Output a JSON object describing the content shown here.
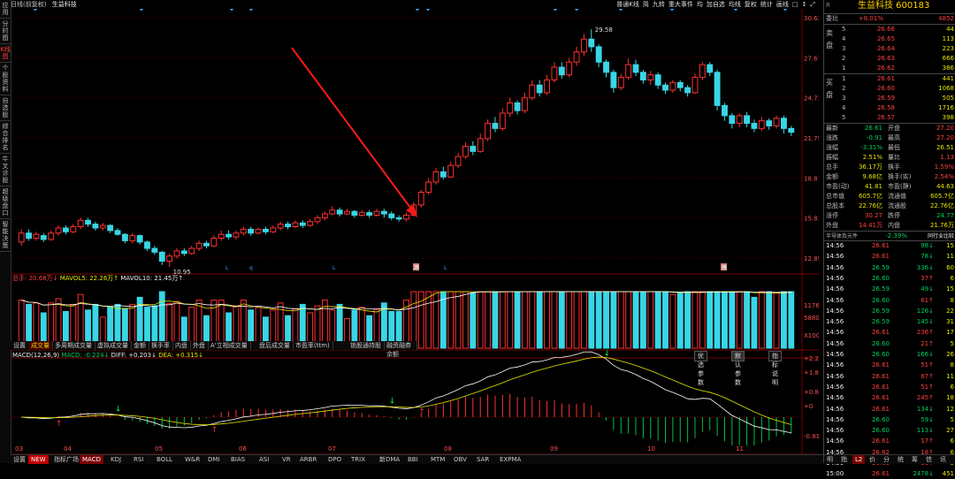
{
  "left_tabs": [
    "应用",
    "分时图",
    "K线图",
    "个股资料",
    "自选股",
    "综合排名",
    "牛叉诊股",
    "超级盘口",
    "智能决策"
  ],
  "left_tab_active": 2,
  "header": {
    "period": "日线(前复权)",
    "stock_name": "生益科技",
    "tools": [
      "普通K线",
      "简",
      "九转",
      "重大事件",
      "均",
      "加自选",
      "均线",
      "复权",
      "统计",
      "画线",
      "□",
      "↕",
      "⤢"
    ]
  },
  "price_axis": [
    "30.62",
    "27.67",
    "24.73",
    "21.75",
    "18.81",
    "15.83",
    "12.89"
  ],
  "price_annotations": {
    "high": "29.58",
    "low": "10.95"
  },
  "event_markers": [
    "L",
    "q",
    "L",
    "港",
    "L",
    "榜"
  ],
  "volume_legend": {
    "total": "总手: 20.68万↓",
    "ma5": "MAVOL5: 22.26万↑",
    "ma10": "MAVOL10: 21.45万↑"
  },
  "volume_axis": [
    "11760",
    "5880",
    "X100"
  ],
  "volume_tabs": [
    "设置",
    "成交量",
    "多周期成交量",
    "虚拟成交量",
    "金额",
    "换手率",
    "内盘",
    "外盘",
    "A'立相成交量",
    "盘后成交量",
    "市盈率(ttm)",
    "锁股通持股",
    "融资融券余额"
  ],
  "volume_tab_active": 1,
  "macd_legend": {
    "name": "MACD(12,26,9)",
    "macd": "MACD: -0.224↓",
    "diff": "DIFF: +0.203↓",
    "dea": "DEA: +0.315↓"
  },
  "macd_buttons": [
    "优选参数",
    "默认参数",
    "指标说明"
  ],
  "macd_axis": [
    "+2.20",
    "+1.86",
    "+0.835",
    "+0",
    "-0.819"
  ],
  "months": [
    "03",
    "04",
    "05",
    "06",
    "07",
    "08",
    "09",
    "10",
    "11"
  ],
  "bottom_tabs": [
    "设置",
    "NEW",
    "指标广场",
    "MACD",
    "KDJ",
    "RSI",
    "BOLL",
    "W&R",
    "DMI",
    "BIAS",
    "ASI",
    "VR",
    "ARBR",
    "DPO",
    "TRIX",
    "新DMA",
    "BBI",
    "MTM",
    "OBV",
    "SAR",
    "EXPMA"
  ],
  "bottom_tab_active": 3,
  "panel": {
    "symbol_r": "R",
    "title": "生益科技 600183",
    "weibi_label": "委比",
    "weibi_value": "+8.01%",
    "weibi_right": "4852",
    "sell_label": "卖盘",
    "buy_label": "买盘",
    "sell": [
      {
        "lvl": "5",
        "price": "26.66",
        "vol": "44"
      },
      {
        "lvl": "4",
        "price": "26.65",
        "vol": "113"
      },
      {
        "lvl": "3",
        "price": "26.64",
        "vol": "223"
      },
      {
        "lvl": "2",
        "price": "26.63",
        "vol": "666"
      },
      {
        "lvl": "1",
        "price": "26.62",
        "vol": "386"
      }
    ],
    "buy": [
      {
        "lvl": "1",
        "price": "26.61",
        "vol": "441"
      },
      {
        "lvl": "2",
        "price": "26.60",
        "vol": "1068"
      },
      {
        "lvl": "3",
        "price": "26.59",
        "vol": "505"
      },
      {
        "lvl": "4",
        "price": "26.58",
        "vol": "1716"
      },
      {
        "lvl": "5",
        "price": "26.57",
        "vol": "398"
      }
    ],
    "stats": [
      [
        "最新",
        "26.61",
        "开盘",
        "27.20"
      ],
      [
        "涨跌",
        "-0.91",
        "最高",
        "27.20"
      ],
      [
        "涨幅",
        "-3.31%",
        "最低",
        "26.51"
      ],
      [
        "振幅",
        "2.51%",
        "量比",
        "1.13"
      ],
      [
        "总手",
        "36.17万",
        "换手",
        "1.59%"
      ],
      [
        "金额",
        "9.68亿",
        "换手(实)",
        "2.54%"
      ],
      [
        "市盈(动)",
        "41.81",
        "市盈(静)",
        "44.63"
      ],
      [
        "总市值",
        "605.7亿",
        "流通值",
        "605.7亿"
      ],
      [
        "总股本",
        "22.76亿",
        "流通股",
        "22.76亿"
      ],
      [
        "涨停",
        "30.27",
        "跌停",
        "24.77"
      ],
      [
        "外盘",
        "14.41万",
        "内盘",
        "21.76万"
      ]
    ],
    "sector": "半导体及元件",
    "sector_change": "-2.39%",
    "sector_compare": "同行业比较",
    "ticks": [
      [
        "14:56",
        "26.61",
        "98",
        "↓",
        "15"
      ],
      [
        "14:56",
        "26.61",
        "78",
        "↓",
        "11"
      ],
      [
        "14:56",
        "26.59",
        "336",
        "↓",
        "60"
      ],
      [
        "14:56",
        "26.60",
        "37",
        "↑",
        "6"
      ],
      [
        "14:56",
        "26.59",
        "49",
        "↓",
        "15"
      ],
      [
        "14:56",
        "26.60",
        "61",
        "↑",
        "8"
      ],
      [
        "14:56",
        "26.59",
        "126",
        "↓",
        "22"
      ],
      [
        "14:56",
        "26.59",
        "145",
        "↓",
        "31"
      ],
      [
        "14:56",
        "26.61",
        "236",
        "↑",
        "17"
      ],
      [
        "14:56",
        "26.60",
        "21",
        "↑",
        "5"
      ],
      [
        "14:56",
        "26.60",
        "166",
        "↓",
        "26"
      ],
      [
        "14:56",
        "26.61",
        "51",
        "↑",
        "8"
      ],
      [
        "14:56",
        "26.61",
        "87",
        "↑",
        "11"
      ],
      [
        "14:56",
        "26.61",
        "51",
        "↑",
        "6"
      ],
      [
        "14:56",
        "26.61",
        "245",
        "↑",
        "18"
      ],
      [
        "14:56",
        "26.61",
        "134",
        "↓",
        "12"
      ],
      [
        "14:56",
        "26.60",
        "59",
        "↓",
        "5"
      ],
      [
        "14:56",
        "26.60",
        "113",
        "↓",
        "27"
      ],
      [
        "14:56",
        "26.61",
        "17",
        "↑",
        "6"
      ],
      [
        "14:56",
        "26.62",
        "18",
        "↑",
        "6"
      ],
      [
        "14:56",
        "26.63",
        "56",
        "↑",
        "8"
      ],
      [
        "15:00",
        "26.61",
        "2478",
        "↓",
        "451"
      ]
    ],
    "bottom_tabs": [
      "明",
      "指",
      "L2",
      "价",
      "分",
      "统",
      "筹",
      "信",
      "讯"
    ],
    "bottom_tab_active": 2
  },
  "chart_data": {
    "type": "candlestick",
    "x_axis_months": [
      "03",
      "04",
      "05",
      "06",
      "07",
      "08",
      "09",
      "10",
      "11"
    ],
    "price_ylim": [
      10.95,
      30.62
    ],
    "annotations": [
      {
        "label": "29.58",
        "type": "high"
      },
      {
        "label": "10.95",
        "type": "low"
      }
    ],
    "candles": [
      [
        12.9,
        13.6,
        12.6,
        13.9
      ],
      [
        13.6,
        13.2,
        13.0,
        13.9
      ],
      [
        13.2,
        13.5,
        13.0,
        13.7
      ],
      [
        13.4,
        13.1,
        12.9,
        13.6
      ],
      [
        13.1,
        13.6,
        13.0,
        13.8
      ],
      [
        13.6,
        14.0,
        13.4,
        14.2
      ],
      [
        14.0,
        13.7,
        13.5,
        14.2
      ],
      [
        13.7,
        14.1,
        13.6,
        14.3
      ],
      [
        14.1,
        14.6,
        13.9,
        14.8
      ],
      [
        14.6,
        14.3,
        14.1,
        14.8
      ],
      [
        14.3,
        14.0,
        13.8,
        14.5
      ],
      [
        14.0,
        14.2,
        13.8,
        14.4
      ],
      [
        14.2,
        13.8,
        13.6,
        14.3
      ],
      [
        13.8,
        13.5,
        13.4,
        14.0
      ],
      [
        13.5,
        13.0,
        12.8,
        13.6
      ],
      [
        13.0,
        13.4,
        12.8,
        13.6
      ],
      [
        13.4,
        12.9,
        12.7,
        13.5
      ],
      [
        12.9,
        12.4,
        12.2,
        13.0
      ],
      [
        12.4,
        12.1,
        11.9,
        12.6
      ],
      [
        12.1,
        11.4,
        11.1,
        12.2
      ],
      [
        11.4,
        11.8,
        10.95,
        12.0
      ],
      [
        11.8,
        12.2,
        11.6,
        12.4
      ],
      [
        12.2,
        12.0,
        11.8,
        12.4
      ],
      [
        12.0,
        12.4,
        11.9,
        12.6
      ],
      [
        12.4,
        12.8,
        12.2,
        13.0
      ],
      [
        12.8,
        12.6,
        12.4,
        13.0
      ],
      [
        12.6,
        13.2,
        12.5,
        13.4
      ],
      [
        13.2,
        13.5,
        13.0,
        13.8
      ],
      [
        13.5,
        13.3,
        13.1,
        13.8
      ],
      [
        13.3,
        13.6,
        13.1,
        13.8
      ],
      [
        13.6,
        13.9,
        13.4,
        14.1
      ],
      [
        13.9,
        13.6,
        13.4,
        14.1
      ],
      [
        13.6,
        13.9,
        13.5,
        14.0
      ],
      [
        13.9,
        13.7,
        13.5,
        14.1
      ],
      [
        13.7,
        14.0,
        13.6,
        14.2
      ],
      [
        14.0,
        14.3,
        13.8,
        14.5
      ],
      [
        14.3,
        14.1,
        13.9,
        14.5
      ],
      [
        14.1,
        14.4,
        14.0,
        14.6
      ],
      [
        14.4,
        14.2,
        14.0,
        14.6
      ],
      [
        14.2,
        14.5,
        14.1,
        14.7
      ],
      [
        14.5,
        14.8,
        14.3,
        15.0
      ],
      [
        14.8,
        15.1,
        14.6,
        15.3
      ],
      [
        15.1,
        15.4,
        15.0,
        15.7
      ],
      [
        15.4,
        15.1,
        14.9,
        15.6
      ],
      [
        15.1,
        15.3,
        15.0,
        15.5
      ],
      [
        15.3,
        15.0,
        14.8,
        15.4
      ],
      [
        15.0,
        15.2,
        14.9,
        15.4
      ],
      [
        15.2,
        15.0,
        14.8,
        15.4
      ],
      [
        15.0,
        15.3,
        14.9,
        15.5
      ],
      [
        15.3,
        15.1,
        14.8,
        15.5
      ],
      [
        15.1,
        14.8,
        14.6,
        15.3
      ],
      [
        14.8,
        14.7,
        14.5,
        15.0
      ],
      [
        14.7,
        15.0,
        14.5,
        15.2
      ],
      [
        15.0,
        15.8,
        14.9,
        16.0
      ],
      [
        15.8,
        16.8,
        15.6,
        17.0
      ],
      [
        16.8,
        17.6,
        16.6,
        17.9
      ],
      [
        17.6,
        18.4,
        17.4,
        18.7
      ],
      [
        18.4,
        18.0,
        17.8,
        18.8
      ],
      [
        18.0,
        18.9,
        17.9,
        19.2
      ],
      [
        18.9,
        19.6,
        18.7,
        19.9
      ],
      [
        19.6,
        20.4,
        19.4,
        20.7
      ],
      [
        20.4,
        20.0,
        19.7,
        20.8
      ],
      [
        20.0,
        21.0,
        19.9,
        21.4
      ],
      [
        21.0,
        22.2,
        20.8,
        22.5
      ],
      [
        22.2,
        21.8,
        21.5,
        22.7
      ],
      [
        21.8,
        23.0,
        21.6,
        23.4
      ],
      [
        23.0,
        23.8,
        22.7,
        24.2
      ],
      [
        23.8,
        23.2,
        22.9,
        24.0
      ],
      [
        23.2,
        24.2,
        23.0,
        24.6
      ],
      [
        24.2,
        25.2,
        24.0,
        25.6
      ],
      [
        25.2,
        24.6,
        24.3,
        25.6
      ],
      [
        24.6,
        25.6,
        24.4,
        26.0
      ],
      [
        25.6,
        26.6,
        25.4,
        27.0
      ],
      [
        26.6,
        26.0,
        25.7,
        27.0
      ],
      [
        26.0,
        27.0,
        25.8,
        27.3
      ],
      [
        27.0,
        27.8,
        26.7,
        28.2
      ],
      [
        27.8,
        28.8,
        27.5,
        29.2
      ],
      [
        28.8,
        28.2,
        27.8,
        29.58
      ],
      [
        28.2,
        27.0,
        26.6,
        28.4
      ],
      [
        27.0,
        26.2,
        25.8,
        27.2
      ],
      [
        26.2,
        25.0,
        24.6,
        26.4
      ],
      [
        25.0,
        25.8,
        24.8,
        26.1
      ],
      [
        25.8,
        26.8,
        25.6,
        27.3
      ],
      [
        26.8,
        26.2,
        25.9,
        27.2
      ],
      [
        26.2,
        25.6,
        25.3,
        26.4
      ],
      [
        25.6,
        26.0,
        25.2,
        26.3
      ],
      [
        26.0,
        25.2,
        24.9,
        26.2
      ],
      [
        25.2,
        24.8,
        24.5,
        25.4
      ],
      [
        24.8,
        25.4,
        24.6,
        25.6
      ],
      [
        25.4,
        25.0,
        24.7,
        25.6
      ],
      [
        25.0,
        24.6,
        24.3,
        25.2
      ],
      [
        24.6,
        25.8,
        24.5,
        26.1
      ],
      [
        25.8,
        26.8,
        25.6,
        27.0
      ],
      [
        26.8,
        26.2,
        25.9,
        27.0
      ],
      [
        26.2,
        23.6,
        23.2,
        26.4
      ],
      [
        23.6,
        22.8,
        22.4,
        23.8
      ],
      [
        22.8,
        22.2,
        21.8,
        23.0
      ],
      [
        22.2,
        22.8,
        21.9,
        23.0
      ],
      [
        22.8,
        22.2,
        21.9,
        23.1
      ],
      [
        22.2,
        21.8,
        21.5,
        22.5
      ],
      [
        21.8,
        22.4,
        21.6,
        22.7
      ],
      [
        22.4,
        22.0,
        21.7,
        22.6
      ],
      [
        22.0,
        22.6,
        21.8,
        22.8
      ],
      [
        22.6,
        21.8,
        21.4,
        22.8
      ],
      [
        21.8,
        21.5,
        21.2,
        22.0
      ]
    ]
  }
}
